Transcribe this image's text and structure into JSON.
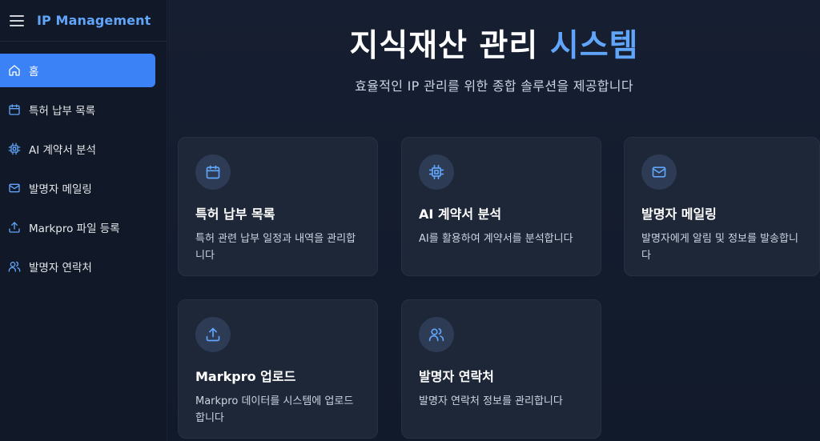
{
  "app": {
    "title": "IP Management"
  },
  "sidebar": {
    "items": [
      {
        "label": "홈",
        "icon": "home-icon",
        "active": true
      },
      {
        "label": "특허 납부 목록",
        "icon": "calendar-icon"
      },
      {
        "label": "AI 계약서 분석",
        "icon": "cpu-icon"
      },
      {
        "label": "발명자 메일링",
        "icon": "mail-icon"
      },
      {
        "label": "Markpro 파일 등록",
        "icon": "upload-icon"
      },
      {
        "label": "발명자 연락처",
        "icon": "users-icon"
      }
    ]
  },
  "hero": {
    "title_main": "지식재산 관리",
    "title_accent": "시스템",
    "subtitle": "효율적인 IP 관리를 위한 종합 솔루션을 제공합니다"
  },
  "cards": [
    {
      "title": "특허 납부 목록",
      "desc": "특허 관련 납부 일정과 내역을 관리합니다",
      "icon": "calendar-icon"
    },
    {
      "title": "AI 계약서 분석",
      "desc": "AI를 활용하여 계약서를 분석합니다",
      "icon": "cpu-icon"
    },
    {
      "title": "발명자 메일링",
      "desc": "발명자에게 알림 및 정보를 발송합니다",
      "icon": "mail-icon"
    },
    {
      "title": "Markpro 업로드",
      "desc": "Markpro 데이터를 시스템에 업로드합니다",
      "icon": "upload-icon"
    },
    {
      "title": "발명자 연락처",
      "desc": "발명자 연락처 정보를 관리합니다",
      "icon": "users-icon"
    }
  ],
  "colors": {
    "accent": "#3b82f6",
    "accent_text": "#60a5fa",
    "background": "#111827",
    "card": "#1e2738"
  }
}
